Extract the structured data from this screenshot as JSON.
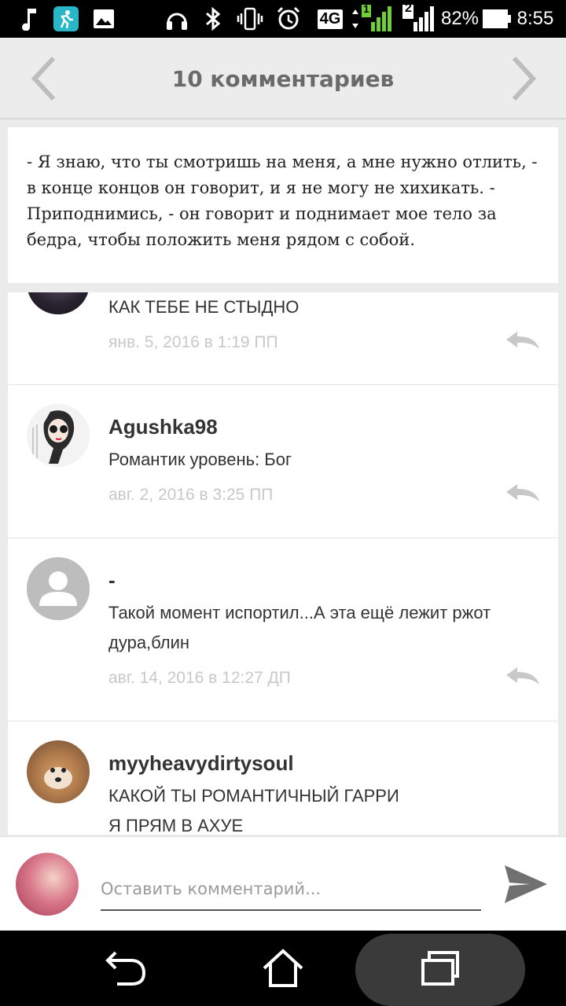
{
  "status_bar": {
    "battery_percent": "82%",
    "time": "8:55",
    "network": "4G",
    "sim1_label": "1",
    "sim2_label": "2"
  },
  "header": {
    "title": "10 комментариев"
  },
  "excerpt": {
    "text": "- Я знаю, что ты смотришь на меня, а мне нужно отлить, - в конце концов он говорит, и я не могу не хихикать. - Приподнимись, - он говорит и поднимает мое тело за бедра, чтобы положить меня рядом с собой."
  },
  "comments": [
    {
      "author": "",
      "text": "КАК ТЕБЕ НЕ СТЫДНО",
      "date": "янв. 5, 2016 в 1:19 ПП"
    },
    {
      "author": "Agushka98",
      "text": "Романтик уровень: Бог",
      "date": "авг. 2, 2016 в 3:25 ПП"
    },
    {
      "author": "-",
      "text": "Такой момент испортил...А эта ещё лежит ржот дура,блин",
      "date": "авг. 14, 2016 в 12:27 ДП"
    },
    {
      "author": "myyheavydirtysoul",
      "text_line1": "КАКОЙ ТЫ РОМАНТИЧНЫЙ ГАРРИ",
      "text_line2": "Я ПРЯМ В АХУЕ"
    }
  ],
  "comment_input": {
    "placeholder": "Оставить комментарий..."
  },
  "colors": {
    "accent_gray": "#6a6a6a",
    "date_gray": "#c8c8c8"
  },
  "icons": [
    "back-arrow-icon",
    "forward-arrow-icon",
    "reply-icon",
    "send-icon",
    "nav-back-icon",
    "nav-home-icon",
    "nav-recents-icon"
  ]
}
